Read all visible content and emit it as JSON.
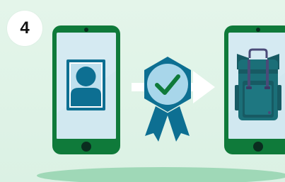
{
  "step": {
    "number": "4"
  },
  "colors": {
    "background": "#dff3e6",
    "phone_body": "#0f7a3a",
    "phone_screen": "#d5eaf2",
    "photo_frame": "#ffffff",
    "person": "#0d6f92",
    "badge_hex": "#0d6f92",
    "badge_inner": "#a8d6ea",
    "check": "#0f7a3a",
    "ribbon": "#0d6f92",
    "arrow": "#ffffff",
    "backpack_body": "#1b6f78",
    "backpack_dark": "#175a63",
    "backpack_strap": "#4a4a78",
    "shadow": "#9fd8b7"
  },
  "icons": {
    "left_phone": "smartphone-icon",
    "profile_photo": "profile-photo-icon",
    "verified_badge": "verified-badge-icon",
    "checkmark": "checkmark-icon",
    "arrow": "arrow-right-icon",
    "right_phone": "smartphone-icon",
    "backpack": "backpack-icon"
  }
}
